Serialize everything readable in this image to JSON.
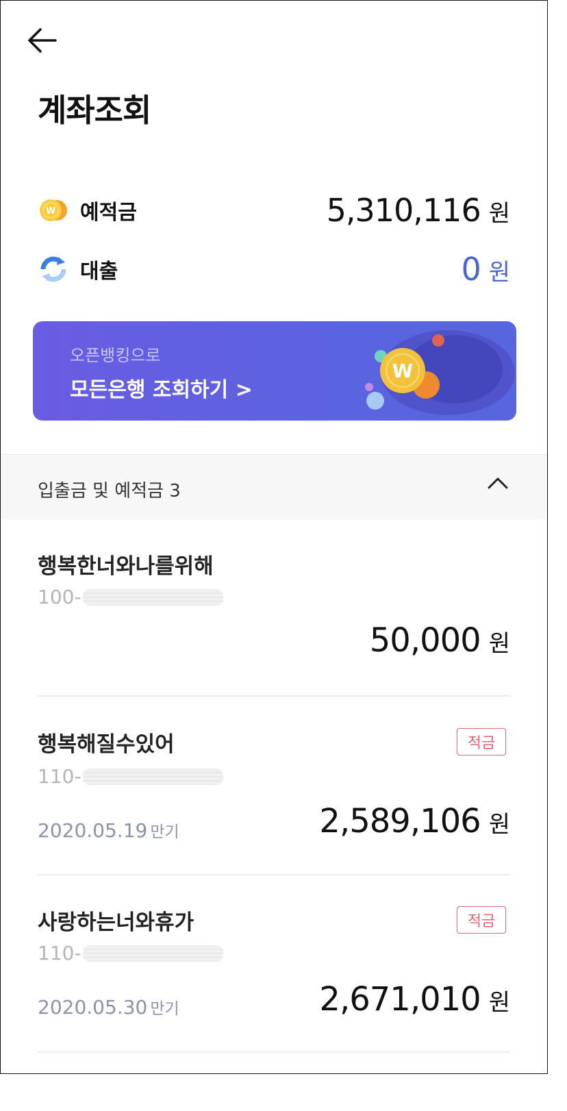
{
  "header": {
    "title": "계좌조회"
  },
  "summary": {
    "deposit": {
      "label": "예적금",
      "amount": "5,310,116",
      "unit": "원"
    },
    "loan": {
      "label": "대출",
      "amount": "0",
      "unit": "원"
    }
  },
  "banner": {
    "subtitle": "오픈뱅킹으로",
    "title": "모든은행 조회하기 >"
  },
  "section": {
    "label": "입출금 및 예적금 3"
  },
  "accounts": [
    {
      "name": "행복한너와나를위해",
      "number_prefix": "100-",
      "amount": "50,000",
      "unit": "원"
    },
    {
      "name": "행복해질수있어",
      "number_prefix": "110-",
      "badge": "적금",
      "maturity": "2020.05.19",
      "maturity_suffix": "만기",
      "amount": "2,589,106",
      "unit": "원"
    },
    {
      "name": "사랑하는너와휴가",
      "number_prefix": "110-",
      "badge": "적금",
      "maturity": "2020.05.30",
      "maturity_suffix": "만기",
      "amount": "2,671,010",
      "unit": "원"
    }
  ],
  "colors": {
    "accent_blue": "#4a64d6",
    "banner": "#5b63e0",
    "badge_red": "#e16375"
  }
}
